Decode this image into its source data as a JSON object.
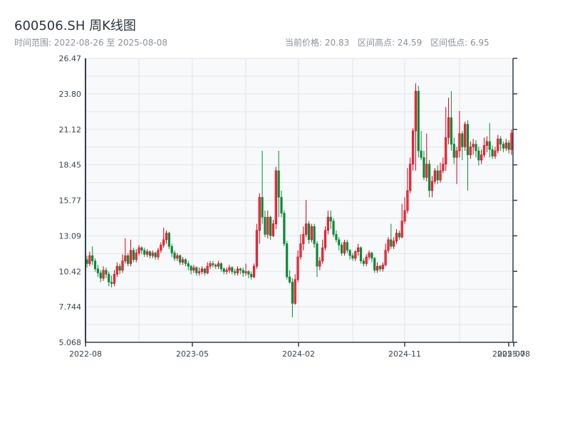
{
  "header": {
    "title": "600506.SH 周K线图",
    "range_label": "时间范围: 2022-08-26 至 2025-08-08",
    "current_price": "当前价格: 20.83",
    "range_high": "区间高点: 24.59",
    "range_low": "区间低点: 6.95"
  },
  "chart_data": {
    "type": "candlestick",
    "title": "600506.SH 周K线图",
    "interval": "weekly",
    "start_date": "2022-08-26",
    "end_date": "2025-08-08",
    "ylim": [
      5.068,
      26.47
    ],
    "y_ticks": [
      "26.47",
      "23.80",
      "21.12",
      "18.45",
      "15.77",
      "13.09",
      "10.42",
      "7.744",
      "5.068"
    ],
    "x_ticks": [
      "2022-08",
      "2023-05",
      "2024-02",
      "2024-11",
      "2025-07",
      "2025-08"
    ],
    "grid": true,
    "colors": {
      "up": "#d0021b",
      "down": "#0a8a35",
      "background": "#f7f9fb",
      "grid": "#e2e5ea",
      "axis": "#2f3d4c"
    },
    "candle_fields": [
      "open",
      "close",
      "low",
      "high"
    ],
    "candles": [
      [
        11.3,
        11.0,
        10.7,
        11.6
      ],
      [
        11.0,
        11.6,
        10.8,
        11.9
      ],
      [
        11.6,
        11.2,
        10.9,
        12.3
      ],
      [
        11.2,
        10.6,
        10.4,
        11.4
      ],
      [
        10.6,
        10.3,
        10.0,
        10.9
      ],
      [
        10.3,
        9.9,
        9.6,
        10.5
      ],
      [
        9.9,
        10.5,
        9.7,
        10.8
      ],
      [
        10.5,
        10.2,
        9.9,
        10.7
      ],
      [
        10.2,
        9.6,
        9.3,
        10.4
      ],
      [
        9.6,
        9.5,
        9.2,
        10.1
      ],
      [
        9.5,
        10.2,
        9.3,
        10.5
      ],
      [
        10.2,
        10.8,
        10.0,
        11.1
      ],
      [
        10.8,
        10.5,
        10.2,
        11.0
      ],
      [
        10.5,
        11.2,
        10.3,
        11.7
      ],
      [
        11.2,
        11.6,
        11.0,
        12.9
      ],
      [
        11.6,
        11.0,
        10.8,
        11.8
      ],
      [
        11.0,
        12.0,
        10.8,
        12.8
      ],
      [
        12.0,
        11.3,
        11.1,
        12.2
      ],
      [
        11.3,
        11.8,
        11.1,
        12.1
      ],
      [
        11.8,
        12.2,
        11.6,
        12.4
      ],
      [
        12.2,
        12.0,
        11.7,
        12.3
      ],
      [
        12.0,
        11.7,
        11.5,
        12.2
      ],
      [
        11.7,
        11.9,
        11.5,
        12.1
      ],
      [
        11.9,
        11.6,
        11.4,
        12.0
      ],
      [
        11.6,
        11.8,
        11.4,
        12.0
      ],
      [
        11.8,
        11.5,
        11.3,
        11.9
      ],
      [
        11.5,
        12.0,
        11.3,
        12.2
      ],
      [
        12.0,
        12.4,
        11.8,
        12.6
      ],
      [
        12.4,
        12.8,
        12.2,
        13.7
      ],
      [
        12.8,
        13.3,
        12.5,
        13.5
      ],
      [
        13.3,
        12.3,
        12.1,
        13.4
      ],
      [
        12.3,
        11.8,
        11.5,
        12.5
      ],
      [
        11.8,
        11.4,
        11.2,
        12.0
      ],
      [
        11.4,
        11.6,
        11.2,
        11.8
      ],
      [
        11.6,
        11.1,
        10.9,
        11.7
      ],
      [
        11.1,
        11.3,
        10.9,
        11.5
      ],
      [
        11.3,
        11.0,
        10.8,
        11.4
      ],
      [
        11.0,
        10.8,
        10.5,
        11.2
      ],
      [
        10.8,
        10.5,
        10.2,
        10.9
      ],
      [
        10.5,
        10.7,
        10.3,
        10.9
      ],
      [
        10.7,
        10.3,
        10.1,
        10.8
      ],
      [
        10.3,
        10.4,
        10.1,
        10.7
      ],
      [
        10.4,
        10.6,
        10.2,
        10.8
      ],
      [
        10.6,
        10.3,
        10.1,
        10.7
      ],
      [
        10.3,
        10.8,
        10.2,
        11.1
      ],
      [
        10.8,
        11.0,
        10.6,
        11.2
      ],
      [
        11.0,
        10.9,
        10.7,
        11.2
      ],
      [
        10.9,
        10.8,
        10.6,
        11.0
      ],
      [
        10.8,
        11.0,
        10.6,
        11.2
      ],
      [
        11.0,
        10.6,
        10.4,
        11.1
      ],
      [
        10.6,
        10.4,
        10.2,
        10.7
      ],
      [
        10.4,
        10.5,
        10.2,
        10.7
      ],
      [
        10.5,
        10.7,
        10.3,
        10.9
      ],
      [
        10.7,
        10.4,
        10.2,
        10.8
      ],
      [
        10.4,
        10.3,
        10.1,
        10.6
      ],
      [
        10.3,
        10.6,
        10.1,
        10.8
      ],
      [
        10.6,
        10.5,
        10.2,
        10.7
      ],
      [
        10.5,
        10.3,
        10.0,
        10.7
      ],
      [
        10.3,
        10.4,
        10.1,
        11.0
      ],
      [
        10.4,
        10.2,
        9.9,
        10.5
      ],
      [
        10.2,
        10.0,
        9.8,
        10.4
      ],
      [
        10.0,
        10.8,
        9.9,
        11.0
      ],
      [
        10.8,
        13.5,
        10.6,
        14.0
      ],
      [
        13.5,
        16.0,
        12.5,
        16.3
      ],
      [
        16.0,
        14.5,
        14.0,
        19.5
      ],
      [
        14.5,
        13.2,
        13.0,
        15.0
      ],
      [
        13.2,
        14.5,
        12.9,
        15.0
      ],
      [
        14.5,
        13.1,
        12.8,
        14.6
      ],
      [
        13.1,
        14.0,
        13.0,
        14.3
      ],
      [
        14.0,
        18.0,
        13.6,
        18.3
      ],
      [
        18.0,
        16.0,
        14.5,
        19.5
      ],
      [
        16.0,
        14.8,
        14.5,
        16.5
      ],
      [
        14.8,
        12.5,
        12.3,
        15.0
      ],
      [
        12.5,
        10.0,
        9.8,
        12.7
      ],
      [
        10.0,
        9.6,
        9.5,
        10.5
      ],
      [
        9.6,
        8.0,
        6.95,
        9.9
      ],
      [
        8.0,
        9.8,
        7.9,
        10.2
      ],
      [
        9.8,
        11.5,
        9.6,
        12.0
      ],
      [
        11.5,
        12.5,
        11.3,
        13.2
      ],
      [
        12.5,
        13.2,
        12.0,
        13.8
      ],
      [
        13.2,
        14.0,
        13.0,
        15.8
      ],
      [
        14.0,
        12.8,
        12.5,
        14.2
      ],
      [
        12.8,
        13.8,
        12.6,
        14.0
      ],
      [
        13.8,
        12.5,
        12.2,
        14.0
      ],
      [
        12.5,
        10.8,
        10.0,
        12.7
      ],
      [
        10.8,
        11.2,
        10.5,
        11.5
      ],
      [
        11.2,
        12.2,
        11.0,
        12.8
      ],
      [
        12.2,
        13.5,
        12.0,
        13.8
      ],
      [
        13.5,
        14.5,
        13.2,
        15.0
      ],
      [
        14.5,
        14.2,
        13.6,
        15.0
      ],
      [
        14.2,
        13.2,
        13.0,
        14.4
      ],
      [
        13.2,
        12.8,
        12.6,
        13.5
      ],
      [
        12.8,
        12.4,
        12.0,
        13.0
      ],
      [
        12.4,
        11.8,
        11.6,
        12.6
      ],
      [
        11.8,
        12.6,
        11.6,
        12.8
      ],
      [
        12.6,
        12.0,
        11.8,
        12.8
      ],
      [
        12.0,
        11.6,
        11.3,
        12.1
      ],
      [
        11.6,
        11.4,
        11.2,
        11.8
      ],
      [
        11.4,
        11.9,
        11.2,
        12.0
      ],
      [
        11.9,
        12.2,
        11.6,
        12.5
      ],
      [
        12.2,
        11.2,
        11.0,
        12.3
      ],
      [
        11.2,
        11.0,
        10.8,
        11.4
      ],
      [
        11.0,
        11.5,
        10.8,
        11.7
      ],
      [
        11.5,
        11.8,
        11.3,
        12.0
      ],
      [
        11.8,
        11.4,
        11.1,
        11.9
      ],
      [
        11.4,
        10.5,
        10.3,
        11.5
      ],
      [
        10.5,
        10.8,
        10.3,
        11.1
      ],
      [
        10.8,
        10.6,
        10.4,
        10.9
      ],
      [
        10.6,
        10.9,
        10.4,
        11.1
      ],
      [
        10.9,
        12.0,
        10.8,
        12.5
      ],
      [
        12.0,
        12.8,
        11.8,
        13.0
      ],
      [
        12.8,
        12.3,
        12.1,
        14.0
      ],
      [
        12.3,
        12.7,
        12.1,
        13.0
      ],
      [
        12.7,
        13.3,
        12.5,
        13.6
      ],
      [
        13.3,
        13.0,
        12.8,
        13.5
      ],
      [
        13.0,
        14.2,
        12.9,
        15.5
      ],
      [
        14.2,
        15.0,
        14.0,
        16.0
      ],
      [
        15.0,
        16.5,
        14.8,
        18.2
      ],
      [
        16.5,
        18.5,
        16.3,
        19.0
      ],
      [
        18.5,
        21.0,
        18.0,
        21.2
      ],
      [
        21.0,
        24.0,
        18.0,
        24.59
      ],
      [
        24.0,
        19.5,
        19.0,
        24.4
      ],
      [
        19.5,
        19.0,
        18.8,
        21.0
      ],
      [
        19.0,
        17.5,
        17.3,
        19.5
      ],
      [
        17.5,
        18.5,
        17.2,
        20.8
      ],
      [
        18.5,
        16.5,
        16.0,
        18.8
      ],
      [
        16.5,
        17.2,
        16.0,
        17.6
      ],
      [
        17.2,
        18.0,
        17.0,
        18.2
      ],
      [
        18.0,
        17.3,
        17.0,
        18.4
      ],
      [
        17.3,
        18.0,
        17.1,
        18.6
      ],
      [
        18.0,
        18.5,
        17.8,
        19.0
      ],
      [
        18.5,
        20.5,
        18.0,
        22.8
      ],
      [
        20.5,
        22.0,
        20.0,
        23.5
      ],
      [
        22.0,
        20.0,
        19.5,
        24.0
      ],
      [
        20.0,
        19.0,
        18.5,
        20.5
      ],
      [
        19.0,
        19.5,
        17.0,
        19.8
      ],
      [
        19.5,
        20.8,
        19.0,
        22.5
      ],
      [
        20.8,
        19.8,
        18.8,
        21.0
      ],
      [
        19.8,
        21.5,
        19.5,
        21.7
      ],
      [
        21.5,
        19.2,
        16.5,
        21.8
      ],
      [
        19.2,
        19.8,
        18.9,
        20.2
      ],
      [
        19.8,
        20.0,
        19.2,
        20.4
      ],
      [
        20.0,
        19.5,
        19.0,
        20.3
      ],
      [
        19.5,
        18.8,
        18.4,
        19.8
      ],
      [
        18.8,
        19.2,
        18.5,
        19.6
      ],
      [
        19.2,
        19.9,
        19.0,
        20.5
      ],
      [
        19.9,
        20.2,
        19.4,
        20.6
      ],
      [
        20.2,
        19.6,
        19.0,
        21.6
      ],
      [
        19.6,
        19.1,
        18.9,
        19.9
      ],
      [
        19.1,
        19.5,
        18.9,
        19.8
      ],
      [
        19.5,
        20.4,
        19.3,
        20.7
      ],
      [
        20.4,
        20.0,
        19.5,
        20.6
      ],
      [
        20.0,
        19.7,
        19.4,
        20.2
      ],
      [
        19.7,
        20.1,
        19.5,
        20.4
      ],
      [
        20.1,
        19.6,
        19.3,
        20.3
      ],
      [
        19.6,
        20.83,
        19.2,
        21.1
      ]
    ]
  }
}
